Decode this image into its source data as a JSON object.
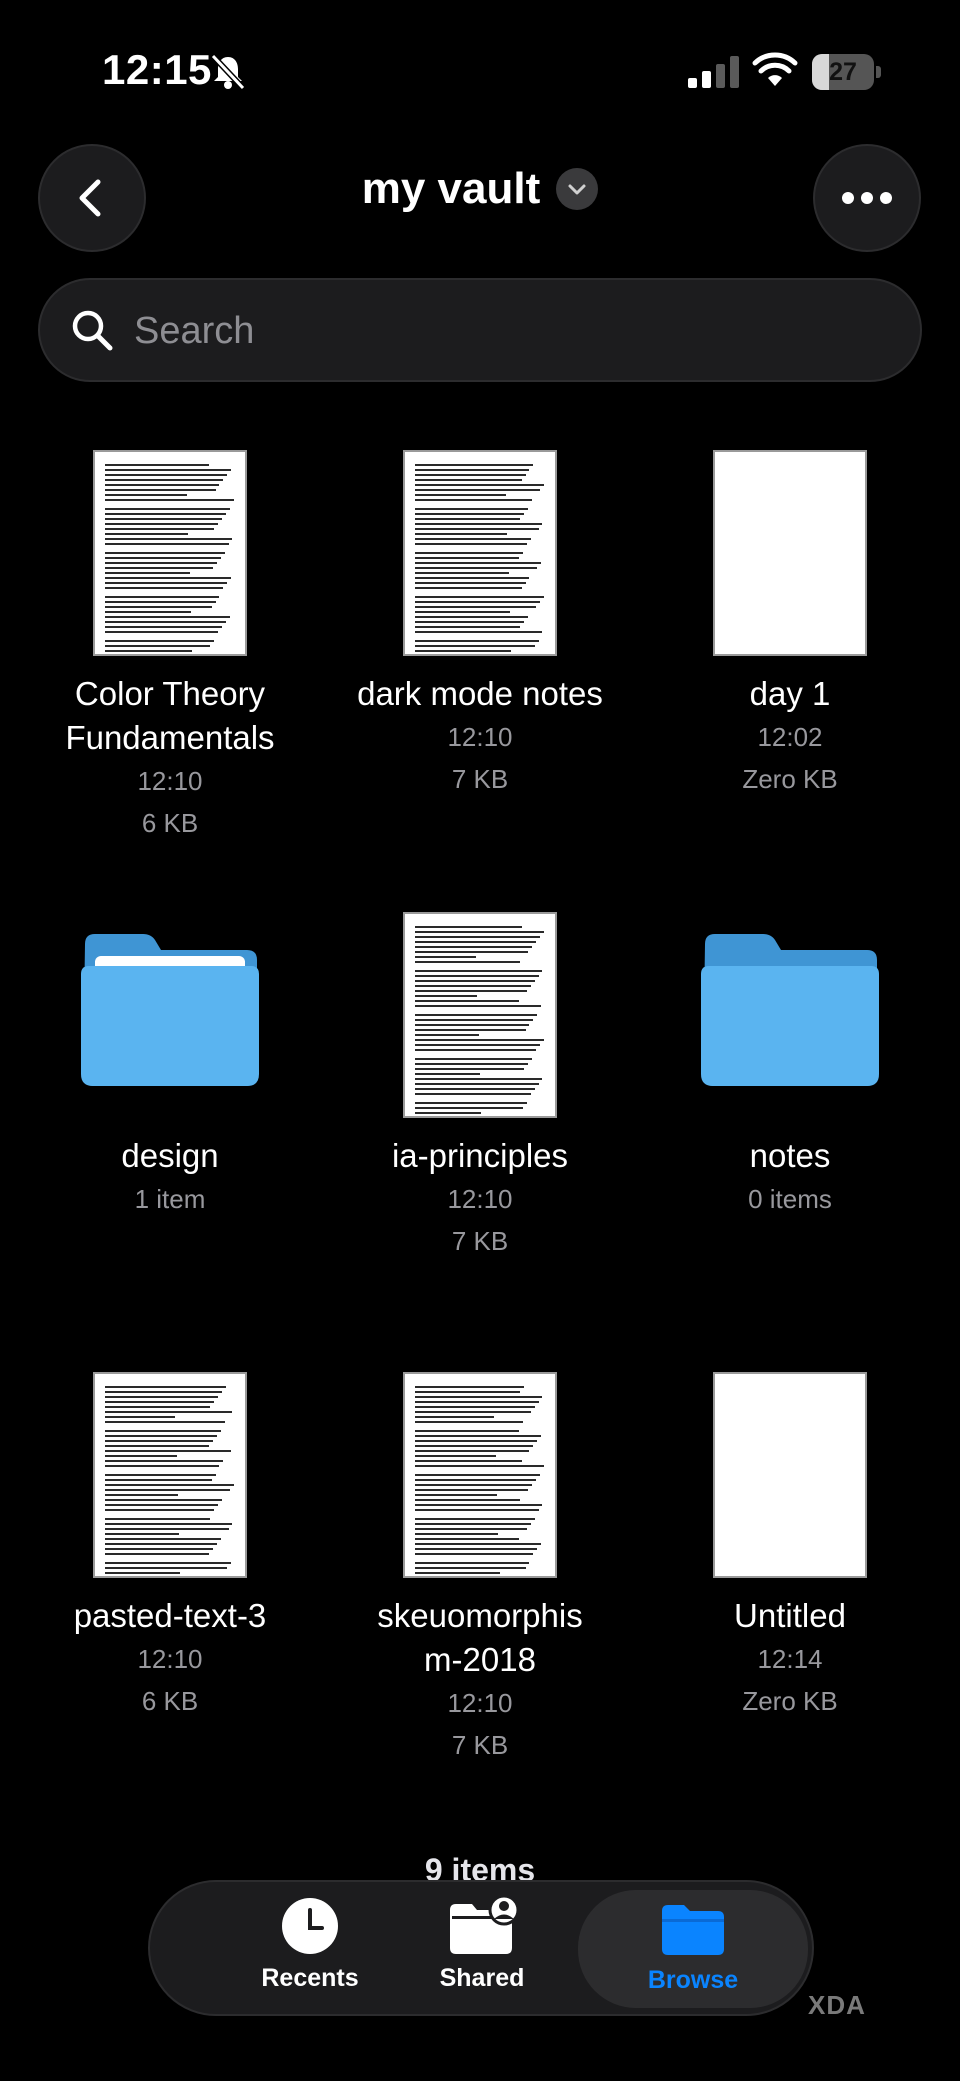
{
  "status_bar": {
    "time": "12:15",
    "battery": "27",
    "battery_level": 0.27
  },
  "header": {
    "title": "my vault",
    "back_icon": "chevron-left-icon",
    "more_icon": "ellipsis-icon"
  },
  "search": {
    "placeholder": "Search",
    "value": ""
  },
  "items": [
    {
      "name": "Color Theory Fundamentals",
      "time": "12:10",
      "size": "6 KB",
      "type": "document"
    },
    {
      "name": "dark mode notes",
      "time": "12:10",
      "size": "7 KB",
      "type": "document"
    },
    {
      "name": "day 1",
      "time": "12:02",
      "size": "Zero KB",
      "type": "blank-document"
    },
    {
      "name": "design",
      "meta": "1 item",
      "type": "folder"
    },
    {
      "name": "ia-principles",
      "time": "12:10",
      "size": "7 KB",
      "type": "document"
    },
    {
      "name": "notes",
      "meta": "0 items",
      "type": "folder"
    },
    {
      "name": "pasted-text-3",
      "time": "12:10",
      "size": "6 KB",
      "type": "document"
    },
    {
      "name": "skeuomorphism-2018",
      "time": "12:10",
      "size": "7 KB",
      "type": "document"
    },
    {
      "name": "Untitled",
      "time": "12:14",
      "size": "Zero KB",
      "type": "blank-document"
    }
  ],
  "footer": {
    "count": "9 items"
  },
  "tabbar": {
    "tabs": [
      {
        "label": "Recents",
        "icon": "clock-icon"
      },
      {
        "label": "Shared",
        "icon": "shared-folder-icon"
      },
      {
        "label": "Browse",
        "icon": "folder-icon",
        "active": true
      }
    ]
  },
  "watermark": "XDA",
  "colors": {
    "accent": "#0a84ff",
    "folder": "#5ab4f0",
    "background": "#000000"
  }
}
